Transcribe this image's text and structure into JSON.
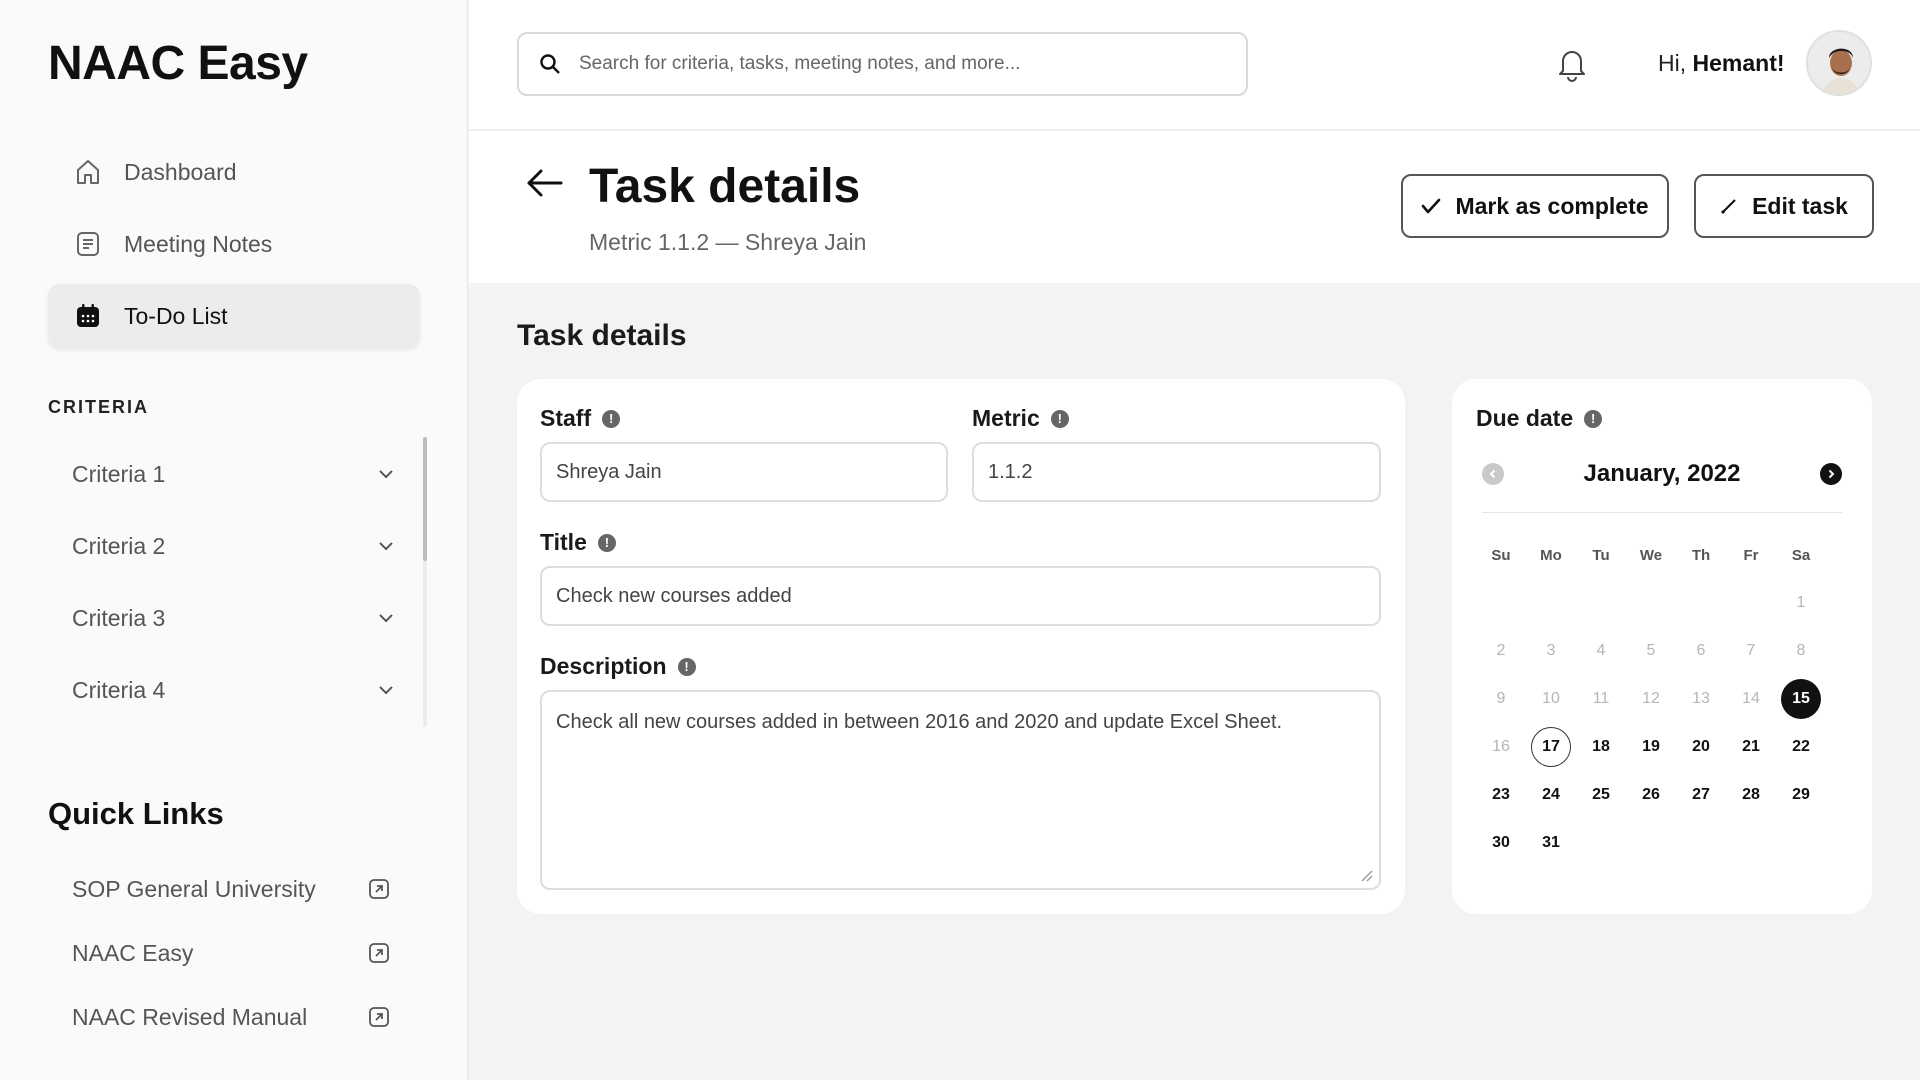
{
  "app": {
    "logo": "NAAC Easy"
  },
  "sidebar": {
    "nav": [
      {
        "label": "Dashboard",
        "icon": "home-icon",
        "active": false
      },
      {
        "label": "Meeting Notes",
        "icon": "notes-icon",
        "active": false
      },
      {
        "label": "To-Do List",
        "icon": "calendar-icon",
        "active": true
      }
    ],
    "criteria_heading": "CRITERIA",
    "criteria": [
      {
        "label": "Criteria 1"
      },
      {
        "label": "Criteria 2"
      },
      {
        "label": "Criteria 3"
      },
      {
        "label": "Criteria 4"
      }
    ],
    "quick_links_heading": "Quick Links",
    "quick_links": [
      {
        "label": "SOP General University"
      },
      {
        "label": "NAAC Easy"
      },
      {
        "label": "NAAC Revised Manual"
      }
    ]
  },
  "topbar": {
    "search_placeholder": "Search for criteria, tasks, meeting notes, and more...",
    "greeting_prefix": "Hi, ",
    "user_name": "Hemant!"
  },
  "header": {
    "title": "Task details",
    "subtitle": "Metric 1.1.2 — Shreya Jain",
    "complete_label": "Mark as complete",
    "edit_label": "Edit task"
  },
  "content": {
    "title": "Task details",
    "form": {
      "staff_label": "Staff",
      "staff_value": "Shreya Jain",
      "metric_label": "Metric",
      "metric_value": "1.1.2",
      "title_label": "Title",
      "title_value": "Check new courses added",
      "description_label": "Description",
      "description_value": "Check all new courses added in between 2016 and 2020 and update Excel Sheet."
    },
    "calendar": {
      "label": "Due date",
      "month": "January, 2022",
      "weekdays": [
        "Su",
        "Mo",
        "Tu",
        "We",
        "Th",
        "Fr",
        "Sa"
      ],
      "leading_blanks": 6,
      "days_in_month": 31,
      "selected_day": 15,
      "today": 17,
      "disabled_before": 17
    }
  },
  "colors": {
    "accent": "#111111",
    "muted": "#b5b5b5",
    "surface": "#f3f3f3"
  }
}
